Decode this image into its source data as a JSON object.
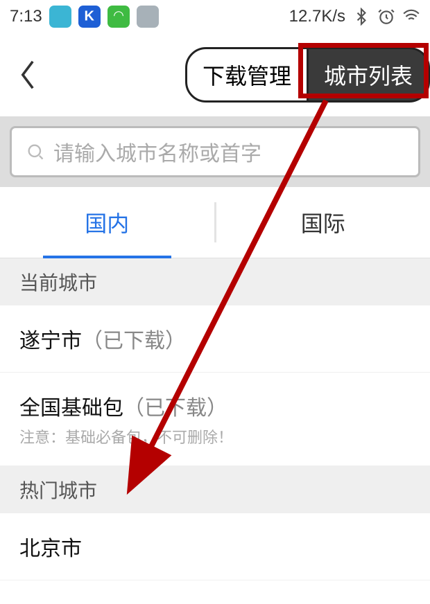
{
  "status": {
    "time": "7:13",
    "speed": "12.7K/s"
  },
  "header": {
    "btn_download": "下载管理",
    "btn_city_list": "城市列表"
  },
  "search": {
    "placeholder": "请输入城市名称或首字"
  },
  "tabs": {
    "domestic": "国内",
    "intl": "国际"
  },
  "sections": {
    "current_city": "当前城市",
    "hot_city": "热门城市"
  },
  "items": {
    "suining": {
      "name": "遂宁市",
      "status": "（已下载）"
    },
    "national": {
      "name": "全国基础包",
      "status": "（已下载）",
      "note": "注意：基础必备包，不可删除！"
    },
    "beijing": {
      "name": "北京市"
    }
  }
}
